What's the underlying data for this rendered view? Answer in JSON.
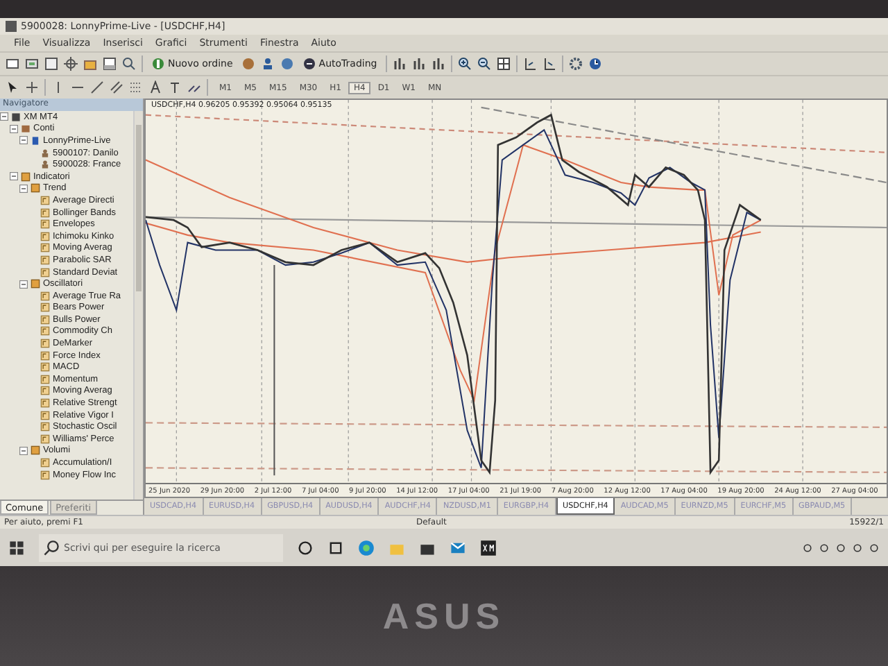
{
  "window": {
    "title": "5900028: LonnyPrime-Live - [USDCHF,H4]"
  },
  "menu": [
    "File",
    "Visualizza",
    "Inserisci",
    "Grafici",
    "Strumenti",
    "Finestra",
    "Aiuto"
  ],
  "toolbar": [
    {
      "label": "Nuovo ordine"
    },
    {
      "label": "AutoTrading"
    }
  ],
  "timeframes": [
    {
      "label": "M1",
      "selected": false
    },
    {
      "label": "M5",
      "selected": false
    },
    {
      "label": "M15",
      "selected": false
    },
    {
      "label": "M30",
      "selected": false
    },
    {
      "label": "H1",
      "selected": false
    },
    {
      "label": "H4",
      "selected": true
    },
    {
      "label": "D1",
      "selected": false
    },
    {
      "label": "W1",
      "selected": false
    },
    {
      "label": "MN",
      "selected": false
    }
  ],
  "navigator": {
    "title": "Navigatore",
    "tree": [
      {
        "label": "XM MT4",
        "kind": "root",
        "expanded": true,
        "children": [
          {
            "label": "Conti",
            "kind": "accounts",
            "expanded": true,
            "children": [
              {
                "label": "LonnyPrime-Live",
                "kind": "server",
                "expanded": true,
                "children": [
                  {
                    "label": "5900107: Danilo",
                    "kind": "account"
                  },
                  {
                    "label": "5900028: France",
                    "kind": "account"
                  }
                ]
              }
            ]
          },
          {
            "label": "Indicatori",
            "kind": "folder",
            "expanded": true,
            "children": [
              {
                "label": "Trend",
                "kind": "folder",
                "expanded": true,
                "children": [
                  {
                    "label": "Average Directi",
                    "kind": "indicator"
                  },
                  {
                    "label": "Bollinger Bands",
                    "kind": "indicator"
                  },
                  {
                    "label": "Envelopes",
                    "kind": "indicator"
                  },
                  {
                    "label": "Ichimoku Kinko",
                    "kind": "indicator"
                  },
                  {
                    "label": "Moving Averag",
                    "kind": "indicator"
                  },
                  {
                    "label": "Parabolic SAR",
                    "kind": "indicator"
                  },
                  {
                    "label": "Standard Deviat",
                    "kind": "indicator"
                  }
                ]
              },
              {
                "label": "Oscillatori",
                "kind": "folder",
                "expanded": true,
                "children": [
                  {
                    "label": "Average True Ra",
                    "kind": "indicator"
                  },
                  {
                    "label": "Bears Power",
                    "kind": "indicator"
                  },
                  {
                    "label": "Bulls Power",
                    "kind": "indicator"
                  },
                  {
                    "label": "Commodity Ch",
                    "kind": "indicator"
                  },
                  {
                    "label": "DeMarker",
                    "kind": "indicator"
                  },
                  {
                    "label": "Force Index",
                    "kind": "indicator"
                  },
                  {
                    "label": "MACD",
                    "kind": "indicator"
                  },
                  {
                    "label": "Momentum",
                    "kind": "indicator"
                  },
                  {
                    "label": "Moving Averag",
                    "kind": "indicator"
                  },
                  {
                    "label": "Relative Strengt",
                    "kind": "indicator"
                  },
                  {
                    "label": "Relative Vigor I",
                    "kind": "indicator"
                  },
                  {
                    "label": "Stochastic Oscil",
                    "kind": "indicator"
                  },
                  {
                    "label": "Williams' Perce",
                    "kind": "indicator"
                  }
                ]
              },
              {
                "label": "Volumi",
                "kind": "folder",
                "expanded": true,
                "children": [
                  {
                    "label": "Accumulation/I",
                    "kind": "indicator"
                  },
                  {
                    "label": "Money Flow Inc",
                    "kind": "indicator"
                  }
                ]
              }
            ]
          }
        ]
      }
    ],
    "tabs": [
      {
        "label": "Comune",
        "selected": true
      },
      {
        "label": "Preferiti",
        "selected": false
      }
    ]
  },
  "chart": {
    "header": "USDCHF,H4  0.96205 0.95392 0.95064 0.95135",
    "dates": [
      "25 Jun 2020",
      "29 Jun 20:00",
      "2 Jul 12:00",
      "7 Jul 04:00",
      "9 Jul 20:00",
      "14 Jul 12:00",
      "17 Jul 04:00",
      "21 Jul 19:00",
      "7 Aug 20:00",
      "12 Aug 12:00",
      "17 Aug 04:00",
      "19 Aug 20:00",
      "24 Aug 12:00",
      "27 Aug 04:00"
    ]
  },
  "chart_tabs": [
    {
      "label": "USDCAD,H4",
      "selected": false
    },
    {
      "label": "EURUSD,H4",
      "selected": false
    },
    {
      "label": "GBPUSD,H4",
      "selected": false
    },
    {
      "label": "AUDUSD,H4",
      "selected": false
    },
    {
      "label": "AUDCHF,H4",
      "selected": false
    },
    {
      "label": "NZDUSD,M1",
      "selected": false
    },
    {
      "label": "EURGBP,H4",
      "selected": false
    },
    {
      "label": "USDCHF,H4",
      "selected": true
    },
    {
      "label": "AUDCAD,M5",
      "selected": false
    },
    {
      "label": "EURNZD,M5",
      "selected": false
    },
    {
      "label": "EURCHF,M5",
      "selected": false
    },
    {
      "label": "GBPAUD,M5",
      "selected": false
    }
  ],
  "status_bar": [
    "Per aiuto, premi F1",
    "Default",
    "15922/1"
  ],
  "taskbar": {
    "search": {
      "placeholder": "Scrivi qui per eseguire la ricerca"
    }
  },
  "bezel": {
    "logo": "ASUS"
  }
}
